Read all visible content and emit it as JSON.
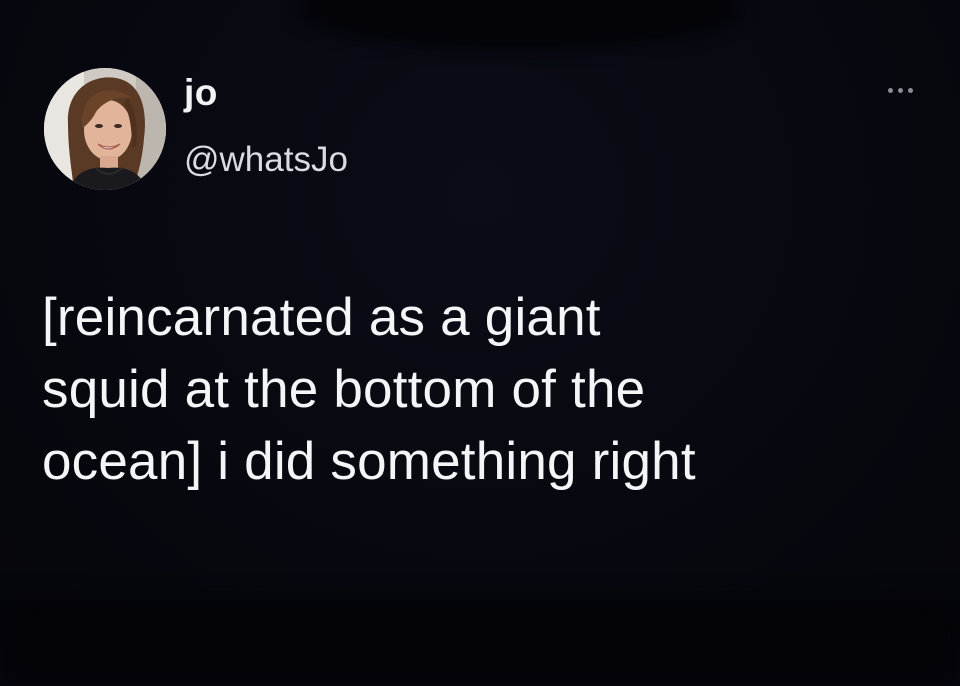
{
  "author": {
    "display_name": "jo",
    "handle": "@whatsJo"
  },
  "tweet": {
    "lines": [
      "[reincarnated as a giant",
      "squid at the bottom of the",
      "ocean] i did something right"
    ]
  },
  "icons": {
    "more": "more-options-icon",
    "avatar": "profile-avatar"
  },
  "colors": {
    "background": "#070810",
    "text": "#f4f5f7",
    "secondary_text": "#d9dce2"
  }
}
